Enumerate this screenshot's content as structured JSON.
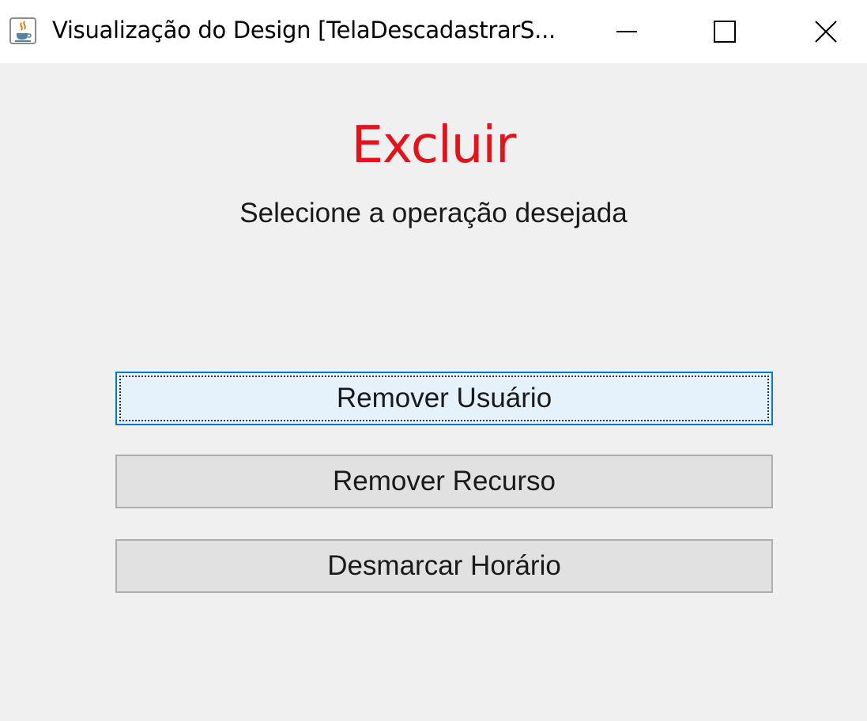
{
  "window": {
    "title": "Visualização do Design [TelaDescadastrarS...",
    "app_icon": "java-cup-icon",
    "controls": {
      "minimize": "minimize-icon",
      "maximize": "maximize-icon",
      "close": "close-icon"
    }
  },
  "main": {
    "heading": "Excluir",
    "subtitle": "Selecione a operação desejada",
    "buttons": [
      {
        "label": "Remover Usuário",
        "focused": true
      },
      {
        "label": "Remover Recurso",
        "focused": false
      },
      {
        "label": "Desmarcar Horário",
        "focused": false
      }
    ]
  },
  "colors": {
    "heading": "#e3121b",
    "background": "#f0f0f0",
    "button": "#e1e1e1",
    "button_focused": "#e5f1fb",
    "focus_border": "#0078d7"
  }
}
